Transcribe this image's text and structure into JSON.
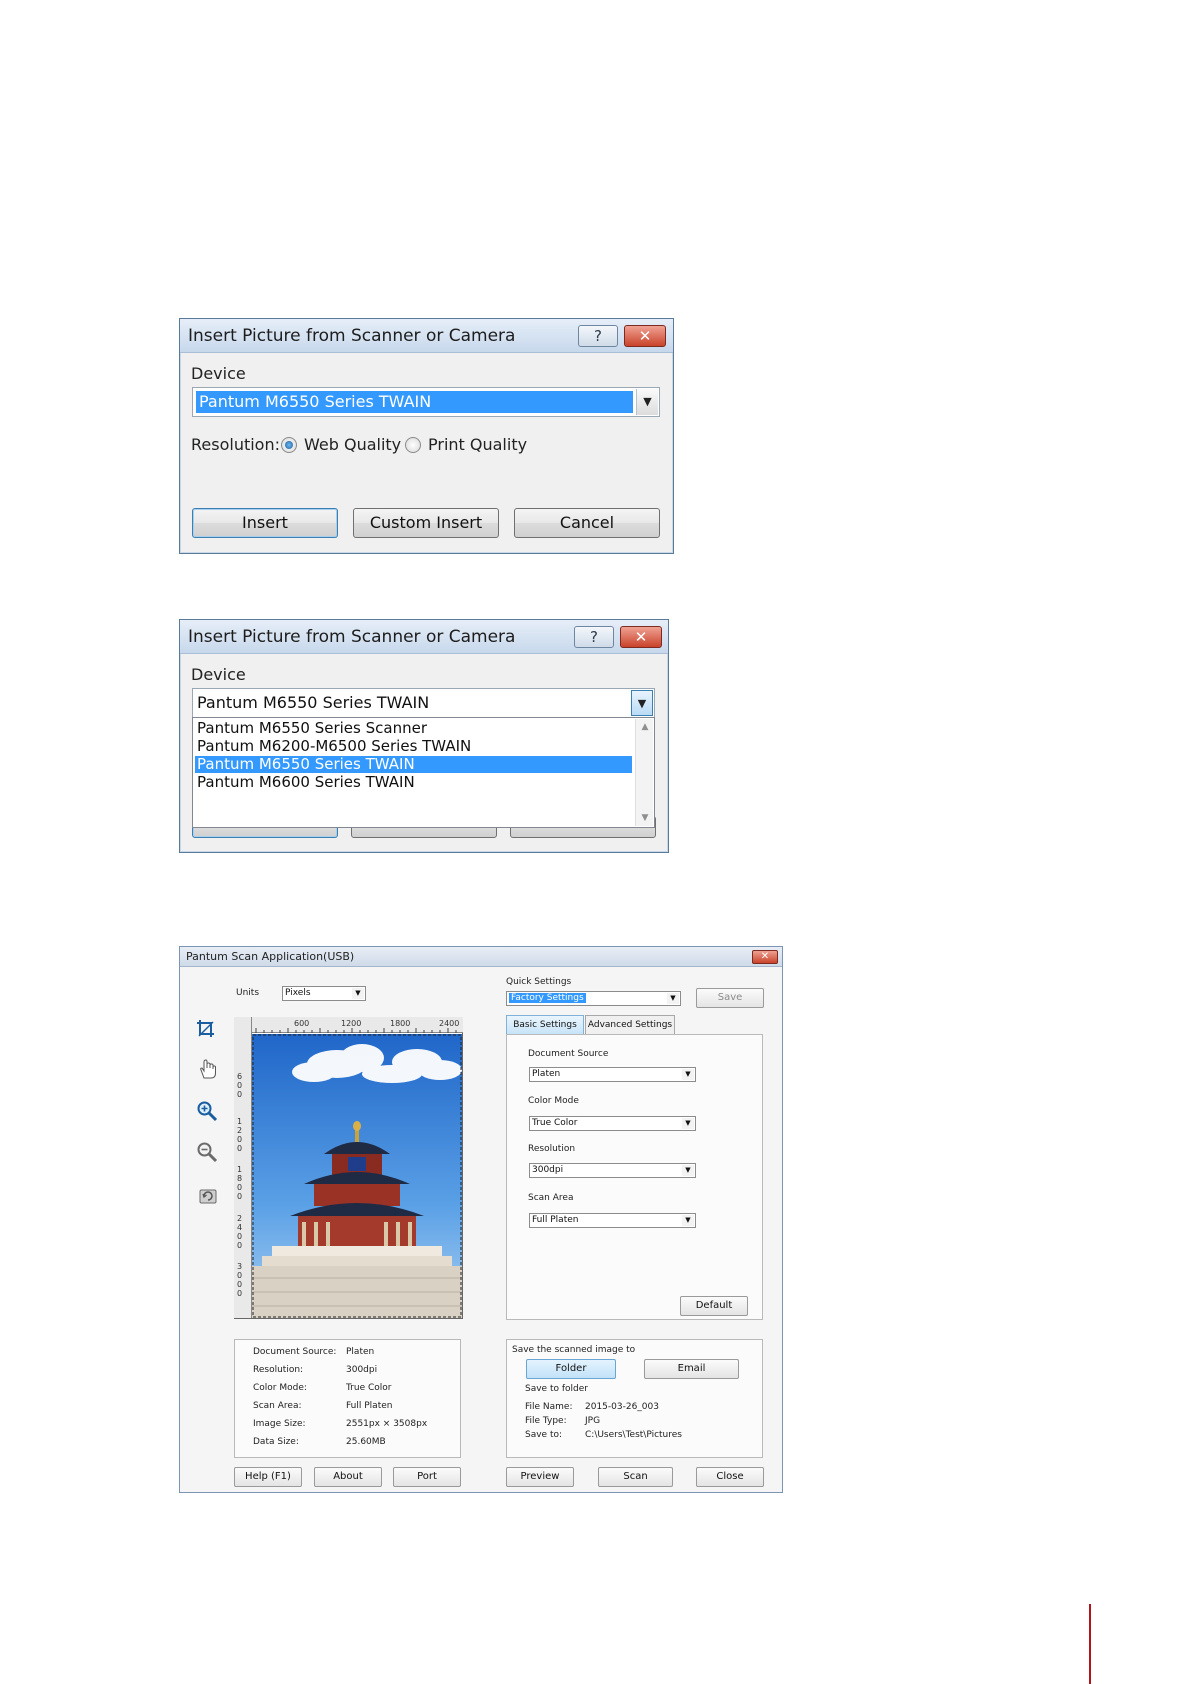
{
  "dialog1": {
    "title": "Insert Picture from Scanner or Camera",
    "help_glyph": "?",
    "close_glyph": "✕",
    "device_label": "Device",
    "device_value": "Pantum M6550 Series TWAIN",
    "resolution_label": "Resolution:",
    "resolution_options": [
      "Web Quality",
      "Print Quality"
    ],
    "resolution_selected": "Web Quality",
    "buttons": {
      "insert": "Insert",
      "custom_insert": "Custom Insert",
      "cancel": "Cancel"
    }
  },
  "dialog2": {
    "title": "Insert Picture from Scanner or Camera",
    "help_glyph": "?",
    "close_glyph": "✕",
    "device_label": "Device",
    "device_value": "Pantum M6550 Series TWAIN",
    "options": [
      "Pantum M6550 Series Scanner",
      "Pantum M6200-M6500 Series TWAIN",
      "Pantum M6550 Series TWAIN",
      "Pantum M6600 Series TWAIN"
    ],
    "selected_option": "Pantum M6550 Series TWAIN"
  },
  "scan_app": {
    "title": "Pantum Scan Application(USB)",
    "close_glyph": "✕",
    "units_label": "Units",
    "units_value": "Pixels",
    "tools": [
      "crop-icon",
      "hand-icon",
      "zoom-in-icon",
      "zoom-out-icon",
      "rotate-icon"
    ],
    "ruler": {
      "unit": "px",
      "top_ticks": [
        "600",
        "1200",
        "1800",
        "2400"
      ],
      "left_ticks": [
        "600",
        "1200",
        "1800",
        "2400",
        "3000"
      ]
    },
    "quick_settings_label": "Quick Settings",
    "quick_settings_value": "Factory Settings",
    "save_button": "Save",
    "tabs": [
      "Basic Settings",
      "Advanced Settings"
    ],
    "active_tab": "Basic Settings",
    "settings": {
      "document_source_label": "Document Source",
      "document_source_value": "Platen",
      "color_mode_label": "Color Mode",
      "color_mode_value": "True Color",
      "resolution_label": "Resolution",
      "resolution_value": "300dpi",
      "scan_area_label": "Scan Area",
      "scan_area_value": "Full Platen"
    },
    "default_button": "Default",
    "info": [
      {
        "key": "Document Source:",
        "value": "Platen"
      },
      {
        "key": "Resolution:",
        "value": "300dpi"
      },
      {
        "key": "Color Mode:",
        "value": "True Color"
      },
      {
        "key": "Scan Area:",
        "value": "Full Platen"
      },
      {
        "key": "Image Size:",
        "value": "2551px × 3508px"
      },
      {
        "key": "Data Size:",
        "value": "25.60MB"
      }
    ],
    "save_panel": {
      "title": "Save the scanned image to",
      "folder_button": "Folder",
      "email_button": "Email",
      "save_to_folder_label": "Save to folder",
      "file_name_key": "File Name:",
      "file_name_value": "2015-03-26_003",
      "file_type_key": "File Type:",
      "file_type_value": "JPG",
      "save_to_key": "Save to:",
      "save_to_value": "C:\\Users\\Test\\Pictures"
    },
    "bottom_buttons": {
      "help": "Help (F1)",
      "about": "About",
      "port": "Port",
      "preview": "Preview",
      "scan": "Scan",
      "close": "Close"
    }
  }
}
